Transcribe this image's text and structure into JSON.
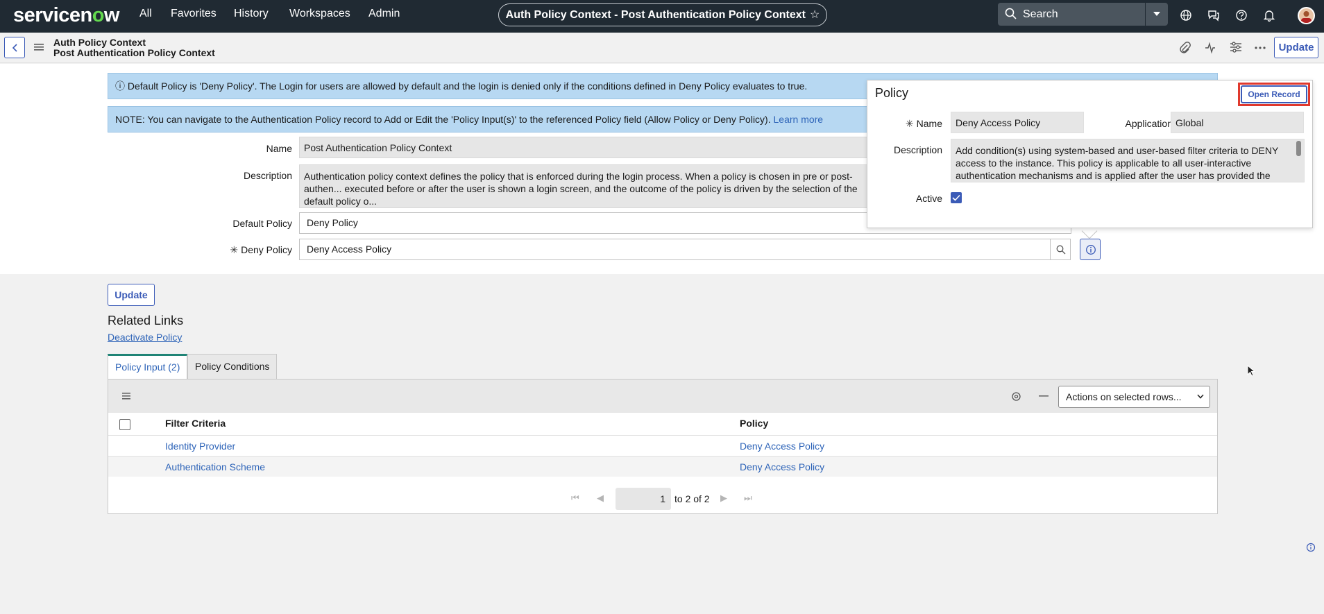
{
  "nav": {
    "logo_a": "servicen",
    "logo_o": "o",
    "logo_b": "w",
    "links": [
      "All",
      "Favorites",
      "History",
      "Workspaces",
      "Admin"
    ],
    "title": "Auth Policy Context - Post Authentication Policy Context",
    "search_placeholder": "Search"
  },
  "header": {
    "line1": "Auth Policy Context",
    "line2": "Post Authentication Policy Context",
    "update_label": "Update"
  },
  "form": {
    "info1": "Default Policy is 'Deny Policy'. The Login for users are allowed by default and the login is denied only if the conditions defined in Deny Policy evaluates to true.",
    "info2": "NOTE: You can navigate to the Authentication Policy record to Add or Edit the 'Policy Input(s)' to the referenced Policy field (Allow Policy or Deny Policy).",
    "info2_link": "Learn more",
    "name_label": "Name",
    "name_value": "Post Authentication Policy Context",
    "description_label": "Description",
    "description_value": "Authentication policy context defines the policy that is enforced during the login process. When a policy is chosen in pre or post-authen... executed before or after the user is shown a login screen, and the outcome of the policy is driven by the selection of the default policy o...",
    "default_policy_label": "Default Policy",
    "default_policy_value": "Deny Policy",
    "deny_policy_label": "Deny Policy",
    "deny_policy_value": "Deny Access Policy"
  },
  "popup": {
    "title": "Policy",
    "open_record": "Open Record",
    "name_label": "Name",
    "name_value": "Deny Access Policy",
    "application_label": "Application",
    "application_value": "Global",
    "description_label": "Description",
    "description_value": "Add condition(s) using system-based and user-based filter criteria to DENY access to the instance. This policy is applicable to all user-interactive authentication mechanisms and is applied after the user has provided the",
    "active_label": "Active"
  },
  "lower": {
    "update_label": "Update",
    "related_links_title": "Related Links",
    "deactivate_link": "Deactivate Policy",
    "tabs": [
      "Policy Input (2)",
      "Policy Conditions"
    ],
    "actions_select": "Actions on selected rows...",
    "columns": [
      "Filter Criteria",
      "Policy"
    ],
    "rows": [
      {
        "filter": "Identity Provider",
        "policy": "Deny Access Policy"
      },
      {
        "filter": "Authentication Scheme",
        "policy": "Deny Access Policy"
      }
    ],
    "page_value": "1",
    "page_text": "to 2 of 2"
  },
  "colors": {
    "nav_bg": "#202a33",
    "accent": "#3b5bb7",
    "logo_o": "#62d84e",
    "info_bg": "#b7d8f2",
    "highlight_red": "#e0392d"
  }
}
